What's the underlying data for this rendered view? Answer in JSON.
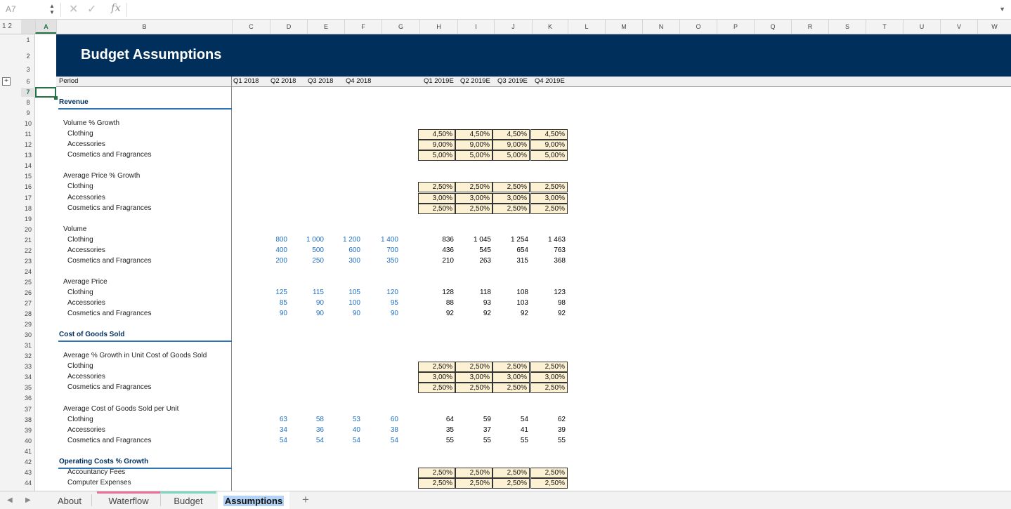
{
  "formula_bar": {
    "cell_ref": "A7",
    "formula": ""
  },
  "outline_levels": "1 2",
  "columns": [
    "A",
    "B",
    "C",
    "D",
    "E",
    "F",
    "G",
    "H",
    "I",
    "J",
    "K",
    "L",
    "M",
    "N",
    "O",
    "P",
    "Q",
    "R",
    "S",
    "T",
    "U",
    "V",
    "W"
  ],
  "selected_column": "A",
  "rows": [
    "1",
    "2",
    "3",
    "6",
    "7",
    "8",
    "9",
    "10",
    "11",
    "12",
    "13",
    "14",
    "15",
    "16",
    "17",
    "18",
    "19",
    "20",
    "21",
    "22",
    "23",
    "24",
    "25",
    "26",
    "27",
    "28",
    "29",
    "30",
    "31",
    "32",
    "33",
    "34",
    "35",
    "36",
    "37",
    "38",
    "39",
    "40",
    "41",
    "42",
    "43",
    "44"
  ],
  "selected_row": "7",
  "sheet": {
    "title": "Budget Assumptions",
    "period_label": "Period",
    "periods_actual": [
      "Q1 2018",
      "Q2 2018",
      "Q3 2018",
      "Q4 2018"
    ],
    "periods_forecast": [
      "Q1 2019E",
      "Q2 2019E",
      "Q3 2019E",
      "Q4 2019E"
    ],
    "lines": [
      {
        "row": "8",
        "text": "Revenue",
        "kind": "section"
      },
      {
        "row": "10",
        "text": "Volume % Growth",
        "kind": "group"
      },
      {
        "row": "11",
        "text": "Clothing",
        "kind": "item",
        "fc": [
          "4,50%",
          "4,50%",
          "4,50%",
          "4,50%"
        ],
        "fctype": "input"
      },
      {
        "row": "12",
        "text": "Accessories",
        "kind": "item",
        "fc": [
          "9,00%",
          "9,00%",
          "9,00%",
          "9,00%"
        ],
        "fctype": "input"
      },
      {
        "row": "13",
        "text": "Cosmetics and Fragrances",
        "kind": "item",
        "fc": [
          "5,00%",
          "5,00%",
          "5,00%",
          "5,00%"
        ],
        "fctype": "input"
      },
      {
        "row": "15",
        "text": "Average Price % Growth",
        "kind": "group"
      },
      {
        "row": "16",
        "text": "Clothing",
        "kind": "item",
        "fc": [
          "2,50%",
          "2,50%",
          "2,50%",
          "2,50%"
        ],
        "fctype": "input"
      },
      {
        "row": "17",
        "text": "Accessories",
        "kind": "item",
        "fc": [
          "3,00%",
          "3,00%",
          "3,00%",
          "3,00%"
        ],
        "fctype": "input"
      },
      {
        "row": "18",
        "text": "Cosmetics and Fragrances",
        "kind": "item",
        "fc": [
          "2,50%",
          "2,50%",
          "2,50%",
          "2,50%"
        ],
        "fctype": "input"
      },
      {
        "row": "20",
        "text": "Volume",
        "kind": "group"
      },
      {
        "row": "21",
        "text": "Clothing",
        "kind": "item",
        "act": [
          "800",
          "1 000",
          "1 200",
          "1 400"
        ],
        "fc": [
          "836",
          "1 045",
          "1 254",
          "1 463"
        ],
        "fctype": "calc"
      },
      {
        "row": "22",
        "text": "Accessories",
        "kind": "item",
        "act": [
          "400",
          "500",
          "600",
          "700"
        ],
        "fc": [
          "436",
          "545",
          "654",
          "763"
        ],
        "fctype": "calc"
      },
      {
        "row": "23",
        "text": "Cosmetics and Fragrances",
        "kind": "item",
        "act": [
          "200",
          "250",
          "300",
          "350"
        ],
        "fc": [
          "210",
          "263",
          "315",
          "368"
        ],
        "fctype": "calc"
      },
      {
        "row": "25",
        "text": "Average Price",
        "kind": "group"
      },
      {
        "row": "26",
        "text": "Clothing",
        "kind": "item",
        "act": [
          "125",
          "115",
          "105",
          "120"
        ],
        "fc": [
          "128",
          "118",
          "108",
          "123"
        ],
        "fctype": "calc"
      },
      {
        "row": "27",
        "text": "Accessories",
        "kind": "item",
        "act": [
          "85",
          "90",
          "100",
          "95"
        ],
        "fc": [
          "88",
          "93",
          "103",
          "98"
        ],
        "fctype": "calc"
      },
      {
        "row": "28",
        "text": "Cosmetics and Fragrances",
        "kind": "item",
        "act": [
          "90",
          "90",
          "90",
          "90"
        ],
        "fc": [
          "92",
          "92",
          "92",
          "92"
        ],
        "fctype": "calc"
      },
      {
        "row": "30",
        "text": "Cost of Goods Sold",
        "kind": "section"
      },
      {
        "row": "32",
        "text": "Average % Growth in Unit Cost of Goods Sold",
        "kind": "group"
      },
      {
        "row": "33",
        "text": "Clothing",
        "kind": "item",
        "fc": [
          "2,50%",
          "2,50%",
          "2,50%",
          "2,50%"
        ],
        "fctype": "input"
      },
      {
        "row": "34",
        "text": "Accessories",
        "kind": "item",
        "fc": [
          "3,00%",
          "3,00%",
          "3,00%",
          "3,00%"
        ],
        "fctype": "input"
      },
      {
        "row": "35",
        "text": "Cosmetics and Fragrances",
        "kind": "item",
        "fc": [
          "2,50%",
          "2,50%",
          "2,50%",
          "2,50%"
        ],
        "fctype": "input"
      },
      {
        "row": "37",
        "text": "Average Cost of Goods Sold per Unit",
        "kind": "group"
      },
      {
        "row": "38",
        "text": "Clothing",
        "kind": "item",
        "act": [
          "63",
          "58",
          "53",
          "60"
        ],
        "fc": [
          "64",
          "59",
          "54",
          "62"
        ],
        "fctype": "calc"
      },
      {
        "row": "39",
        "text": "Accessories",
        "kind": "item",
        "act": [
          "34",
          "36",
          "40",
          "38"
        ],
        "fc": [
          "35",
          "37",
          "41",
          "39"
        ],
        "fctype": "calc"
      },
      {
        "row": "40",
        "text": "Cosmetics and Fragrances",
        "kind": "item",
        "act": [
          "54",
          "54",
          "54",
          "54"
        ],
        "fc": [
          "55",
          "55",
          "55",
          "55"
        ],
        "fctype": "calc"
      },
      {
        "row": "42",
        "text": "Operating Costs % Growth",
        "kind": "section"
      },
      {
        "row": "43",
        "text": "Accountancy Fees",
        "kind": "item",
        "fc": [
          "2,50%",
          "2,50%",
          "2,50%",
          "2,50%"
        ],
        "fctype": "input"
      },
      {
        "row": "44",
        "text": "Computer Expenses",
        "kind": "item",
        "fc": [
          "2,50%",
          "2,50%",
          "2,50%",
          "2,50%"
        ],
        "fctype": "input"
      }
    ]
  },
  "tabs": [
    {
      "label": "About",
      "accent": ""
    },
    {
      "label": "Waterflow",
      "accent": "#e8739a"
    },
    {
      "label": "Budget",
      "accent": "#7fd6c2"
    },
    {
      "label": "Assumptions",
      "accent": "",
      "active": true
    }
  ],
  "colors": {
    "banner": "#002f5c",
    "input_fill": "#fdf1d3",
    "actual_font": "#1f6fc4",
    "select": "#217346"
  }
}
